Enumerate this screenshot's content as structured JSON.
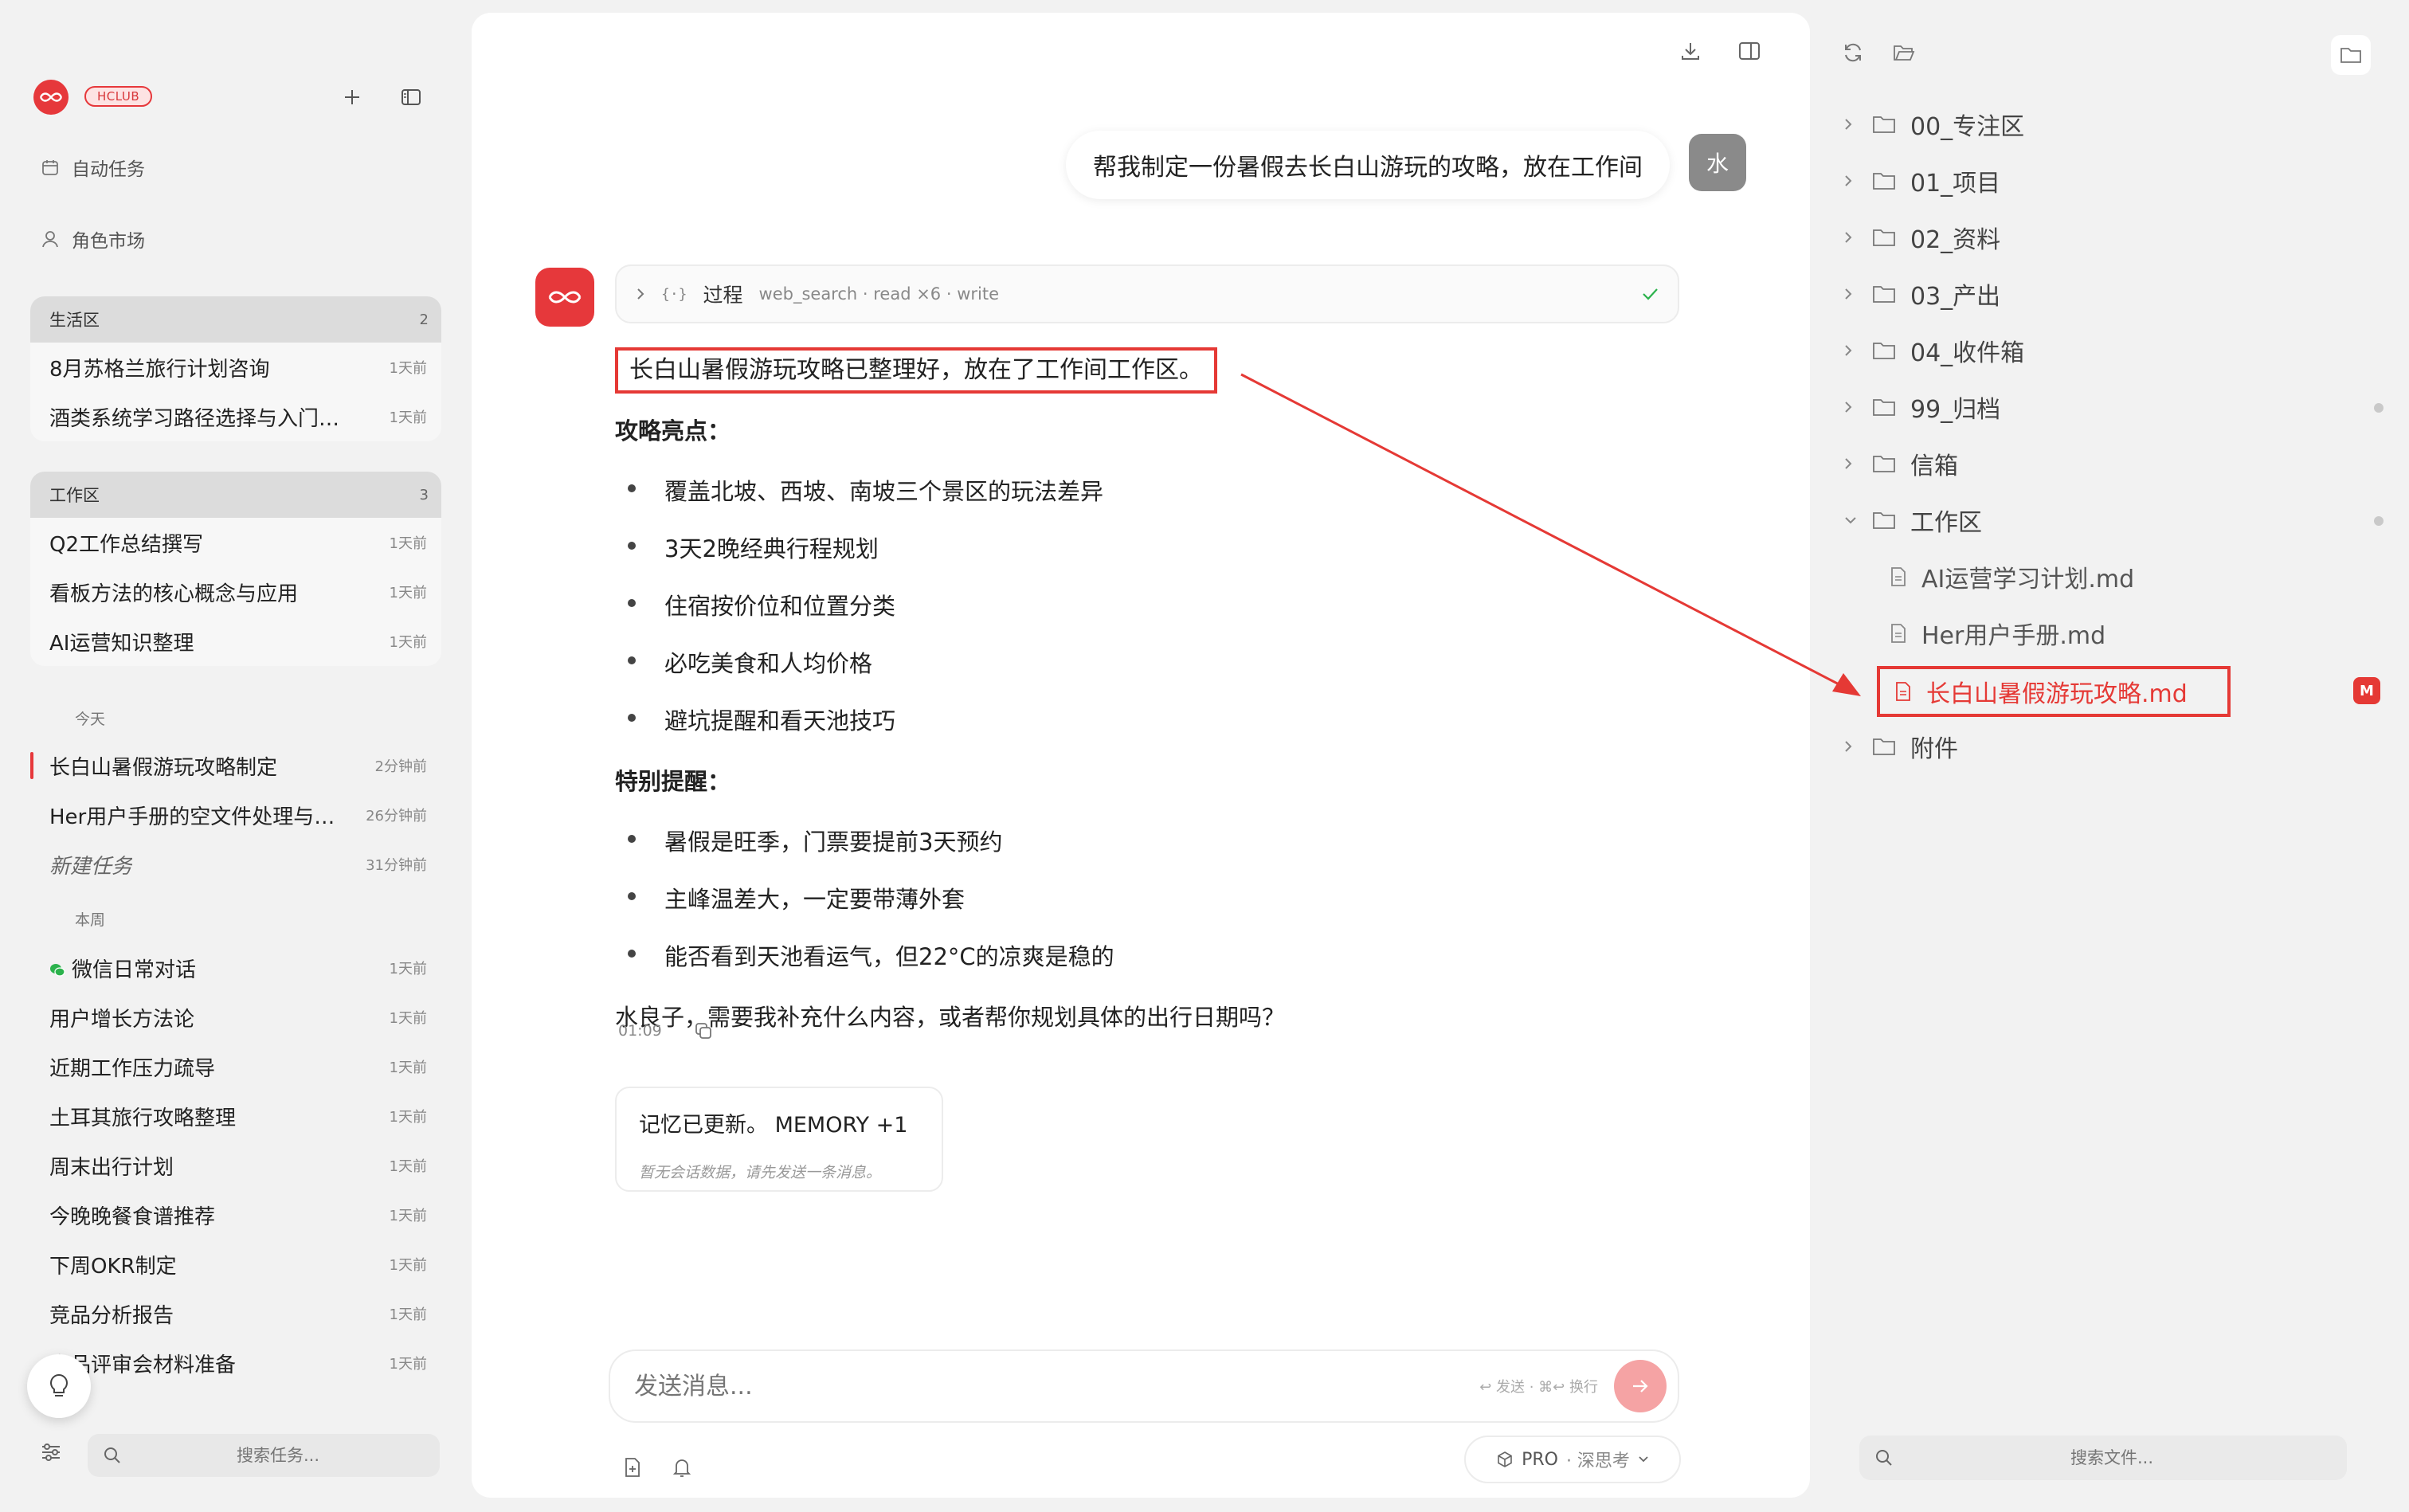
{
  "sidebar": {
    "badge": "HCLUB",
    "nav": [
      {
        "label": "自动任务",
        "icon": "calendar-icon"
      },
      {
        "label": "角色市场",
        "icon": "user-icon"
      }
    ],
    "groups": [
      {
        "title": "生活区",
        "count": "2",
        "items": [
          {
            "title": "8月苏格兰旅行计划咨询",
            "time": "1天前"
          },
          {
            "title": "酒类系统学习路径选择与入门…",
            "time": "1天前"
          }
        ]
      },
      {
        "title": "工作区",
        "count": "3",
        "items": [
          {
            "title": "Q2工作总结撰写",
            "time": "1天前"
          },
          {
            "title": "看板方法的核心概念与应用",
            "time": "1天前"
          },
          {
            "title": "AI运营知识整理",
            "time": "1天前"
          }
        ]
      }
    ],
    "today_label": "今天",
    "today": [
      {
        "title": "长白山暑假游玩攻略制定",
        "time": "2分钟前"
      },
      {
        "title": "Her用户手册的空文件处理与…",
        "time": "26分钟前"
      },
      {
        "title": "新建任务",
        "time": "31分钟前"
      }
    ],
    "week_label": "本周",
    "week": [
      {
        "title": "微信日常对话",
        "time": "1天前"
      },
      {
        "title": "用户增长方法论",
        "time": "1天前"
      },
      {
        "title": "近期工作压力疏导",
        "time": "1天前"
      },
      {
        "title": "土耳其旅行攻略整理",
        "time": "1天前"
      },
      {
        "title": "周末出行计划",
        "time": "1天前"
      },
      {
        "title": "今晚晚餐食谱推荐",
        "time": "1天前"
      },
      {
        "title": "下周OKR制定",
        "time": "1天前"
      },
      {
        "title": "竞品分析报告",
        "time": "1天前"
      },
      {
        "title": "产品评审会材料准备",
        "time": "1天前"
      }
    ],
    "search_placeholder": "搜索任务..."
  },
  "chat": {
    "user_message": "帮我制定一份暑假去长白山游玩的攻略，放在工作间",
    "user_avatar": "水",
    "process": {
      "label": "过程",
      "tools": "web_search · read ×6 · write"
    },
    "answer": {
      "lead": "长白山暑假游玩攻略已整理好，放在了工作间工作区。",
      "h1": "攻略亮点：",
      "list1": [
        "覆盖北坡、西坡、南坡三个景区的玩法差异",
        "3天2晚经典行程规划",
        "住宿按价位和位置分类",
        "必吃美食和人均价格",
        "避坑提醒和看天池技巧"
      ],
      "h2": "特别提醒：",
      "list2": [
        "暑假是旺季，门票要提前3天预约",
        "主峰温差大，一定要带薄外套",
        "能否看到天池看运气，但22°C的凉爽是稳的"
      ],
      "closing": "水良子，需要我补充什么内容，或者帮你规划具体的出行日期吗？"
    },
    "time": "01:09",
    "memory": {
      "title": "记忆已更新。 MEMORY +1",
      "sub": "暂无会话数据，请先发送一条消息。"
    },
    "composer": {
      "placeholder": "发送消息...",
      "hint": "↩ 发送 · ⌘↩ 换行"
    },
    "model": {
      "name": "PRO",
      "mode": "· 深思考"
    }
  },
  "files": {
    "folders": [
      "00_专注区",
      "01_项目",
      "02_资料",
      "03_产出",
      "04_收件箱",
      "99_归档",
      "信箱",
      "工作区"
    ],
    "workspace_files": [
      "AI运营学习计划.md",
      "Her用户手册.md",
      "长白山暑假游玩攻略.md"
    ],
    "last_folder": "附件",
    "m_badge": "M",
    "search_placeholder": "搜索文件..."
  },
  "colors": {
    "accent": "#e6383b",
    "highlight": "#e53935"
  }
}
